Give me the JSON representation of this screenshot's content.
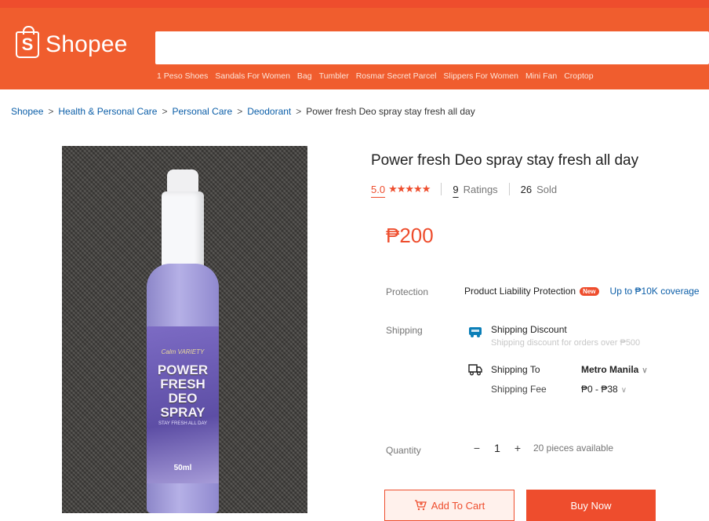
{
  "header": {
    "brand": "Shopee",
    "logo_letter": "S",
    "search": {
      "value": "",
      "placeholder": ""
    },
    "suggestions": [
      "1 Peso Shoes",
      "Sandals For Women",
      "Bag",
      "Tumbler",
      "Rosmar Secret Parcel",
      "Slippers For Women",
      "Mini Fan",
      "Croptop"
    ]
  },
  "breadcrumb": {
    "items": [
      "Shopee",
      "Health & Personal Care",
      "Personal Care",
      "Deodorant"
    ],
    "current": "Power fresh Deo spray stay fresh all day",
    "separator": ">"
  },
  "product_image": {
    "brand_text": "Calm VARIETY",
    "title_text": "POWER FRESH DEO SPRAY",
    "sub_text": "STAY FRESH ALL DAY",
    "volume_text": "50ml"
  },
  "product": {
    "title": "Power fresh Deo spray stay fresh all day",
    "rating": "5.0",
    "stars": "★★★★★",
    "ratings_count": "9",
    "ratings_label": "Ratings",
    "sold_count": "26",
    "sold_label": "Sold",
    "price": "₱200"
  },
  "protection": {
    "label": "Protection",
    "text": "Product Liability Protection",
    "badge": "New",
    "coverage": "Up to ₱10K coverage"
  },
  "shipping": {
    "label": "Shipping",
    "discount_title": "Shipping Discount",
    "discount_sub": "Shipping discount for orders over ₱500",
    "to_label": "Shipping To",
    "to_value": "Metro Manila",
    "fee_label": "Shipping Fee",
    "fee_value": "₱0 - ₱38"
  },
  "quantity": {
    "label": "Quantity",
    "minus": "−",
    "value": "1",
    "plus": "+",
    "available": "20 pieces available"
  },
  "actions": {
    "add_to_cart": "Add To Cart",
    "buy_now": "Buy Now"
  },
  "colors": {
    "brand": "#ee4d2d",
    "header": "#f05d2e",
    "link": "#0b5ea8"
  }
}
